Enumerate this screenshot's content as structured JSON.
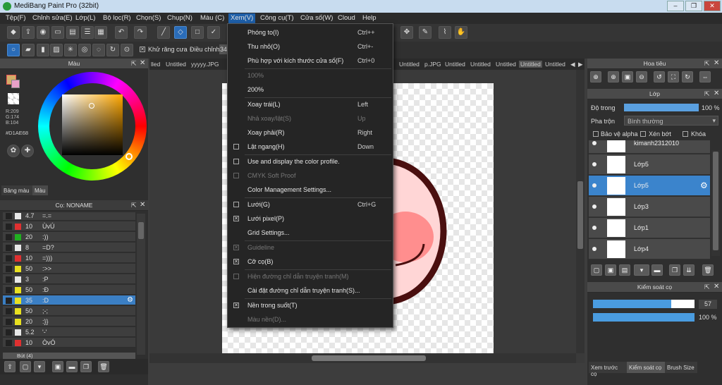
{
  "window": {
    "title": "MediBang Paint Pro (32bit)"
  },
  "menubar": [
    "Tệp(F)",
    "Chỉnh sửa(E)",
    "Lớp(L)",
    "Bộ lọc(R)",
    "Chọn(S)",
    "Chụp(N)",
    "Màu (C)",
    "Xem(V)",
    "Công cụ(T)",
    "Cửa số(W)",
    "Cloud",
    "Help"
  ],
  "toolbar2": {
    "antialias_label": "Khử răng cưa",
    "adjust_label": "Điều chỉnh",
    "adjust_value": "34"
  },
  "tabs": [
    "lled",
    "Untitled",
    "yyyyy.JPG",
    "Untitled",
    "p.JPG",
    "Untitled",
    "Untitled",
    "Untitled",
    "Untitled",
    "Untitled"
  ],
  "color_panel": {
    "title": "Màu",
    "r": "R:209",
    "g": "G:174",
    "b": "B:104",
    "hex": "#D1AE68",
    "tab1": "Bảng màu",
    "tab2": "Màu"
  },
  "brush_panel": {
    "title": "Cọ: NONAME",
    "items": [
      {
        "size": "4.7",
        "name": "=.=",
        "color": "#e8e8e8"
      },
      {
        "size": "10",
        "name": "ÙvÚ",
        "color": "#e03030"
      },
      {
        "size": "20",
        "name": ":))",
        "color": "#20b020"
      },
      {
        "size": "8",
        "name": "=D?",
        "color": "#e8e8e8"
      },
      {
        "size": "10",
        "name": "=)))",
        "color": "#e03030"
      },
      {
        "size": "50",
        "name": ":>>",
        "color": "#e8e020"
      },
      {
        "size": "3",
        "name": ":P",
        "color": "#e8e8e8"
      },
      {
        "size": "50",
        "name": ":Đ",
        "color": "#e8e020"
      },
      {
        "size": "35",
        "name": ":D",
        "color": "#e8e020"
      },
      {
        "size": "50",
        "name": ";-;",
        "color": "#e8e020"
      },
      {
        "size": "20",
        "name": ":}}",
        "color": "#e8e020"
      },
      {
        "size": "5.2",
        "name": "'-'",
        "color": "#e8e8e8"
      },
      {
        "size": "10",
        "name": "ÒvÓ",
        "color": "#e03030"
      }
    ],
    "footer_item": "Bút (4)"
  },
  "view_menu": {
    "items": [
      {
        "label": "Phóng to(I)",
        "shortcut": "Ctrl++",
        "check": "",
        "disabled": false
      },
      {
        "label": "Thu nhỏ(O)",
        "shortcut": "Ctrl+-",
        "check": "",
        "disabled": false
      },
      {
        "label": "Phù hợp với kích thước cửa số(F)",
        "shortcut": "Ctrl+0",
        "check": "",
        "disabled": false
      },
      {
        "label": "100%",
        "shortcut": "",
        "check": "",
        "disabled": true
      },
      {
        "label": "200%",
        "shortcut": "",
        "check": "",
        "disabled": false
      },
      {
        "label": "Xoay trái(L)",
        "shortcut": "Left",
        "check": "",
        "disabled": false
      },
      {
        "label": "Nhả xoay/lật(S)",
        "shortcut": "Up",
        "check": "",
        "disabled": true
      },
      {
        "label": "Xoay phải(R)",
        "shortcut": "Right",
        "check": "",
        "disabled": false
      },
      {
        "label": "Lật ngang(H)",
        "shortcut": "Down",
        "check": "box",
        "disabled": false
      },
      {
        "label": "Use and display the color profile.",
        "shortcut": "",
        "check": "box",
        "disabled": false
      },
      {
        "label": "CMYK Soft Proof",
        "shortcut": "",
        "check": "box",
        "disabled": true
      },
      {
        "label": "Color Management Settings...",
        "shortcut": "",
        "check": "",
        "disabled": false
      },
      {
        "label": "Lưới(G)",
        "shortcut": "Ctrl+G",
        "check": "box",
        "disabled": false
      },
      {
        "label": "Lưới pixel(P)",
        "shortcut": "",
        "check": "checked",
        "disabled": false
      },
      {
        "label": "Grid Settings...",
        "shortcut": "",
        "check": "",
        "disabled": false
      },
      {
        "label": "Guideline",
        "shortcut": "",
        "check": "checked",
        "disabled": true
      },
      {
        "label": "Cỡ cọ(B)",
        "shortcut": "",
        "check": "checked",
        "disabled": false
      },
      {
        "label": "Hiện đường chỉ dẫn truyện tranh(M)",
        "shortcut": "",
        "check": "box",
        "disabled": true
      },
      {
        "label": "Cài đặt đường chỉ dẫn truyện tranh(S)...",
        "shortcut": "",
        "check": "",
        "disabled": false
      },
      {
        "label": "Nền trong suốt(T)",
        "shortcut": "",
        "check": "checked",
        "disabled": false
      },
      {
        "label": "Màu nền(D)...",
        "shortcut": "",
        "check": "",
        "disabled": true
      }
    ]
  },
  "navigator": {
    "title": "Hoa tiêu"
  },
  "layers": {
    "title": "Lớp",
    "opacity_label": "Độ trong",
    "opacity_value": "100 %",
    "opacity": 1.0,
    "blend_label": "Pha trộn",
    "blend_value": "Bình thường",
    "protect_alpha": "Bảo vệ alpha",
    "clip": "Xén bớt",
    "lock": "Khóa",
    "items": [
      {
        "name": "kimanh2312010",
        "selected": false
      },
      {
        "name": "Lớp5",
        "selected": false
      },
      {
        "name": "Lớp5",
        "selected": true
      },
      {
        "name": "Lớp3",
        "selected": false
      },
      {
        "name": "Lớp1",
        "selected": false
      },
      {
        "name": "Lớp4",
        "selected": false
      }
    ]
  },
  "brush_control": {
    "title": "Kiểm soát cọ",
    "size_value": "57",
    "size_fraction": 0.77,
    "opacity_value": "100 %",
    "opacity_fraction": 1.0,
    "tabs": [
      "Xem trước cọ",
      "Kiểm soát cọ",
      "Brush Size"
    ]
  },
  "colors": {
    "accent": "#3b84cc",
    "menu_bg": "#252525",
    "current_color": "#D1AE68"
  }
}
